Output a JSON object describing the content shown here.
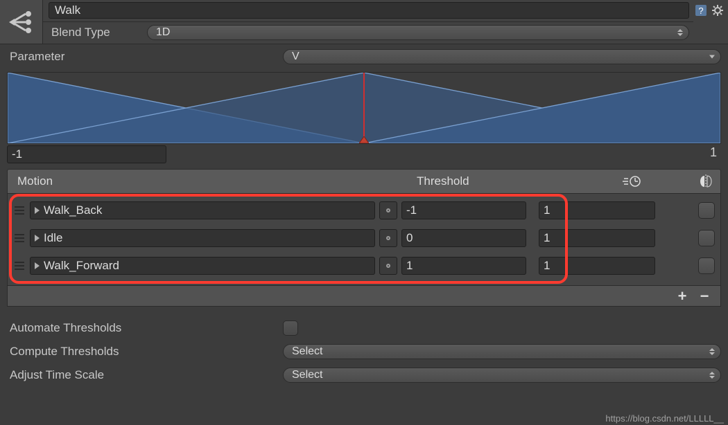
{
  "header": {
    "name": "Walk",
    "blend_type_label": "Blend Type",
    "blend_type_value": "1D"
  },
  "parameter": {
    "label": "Parameter",
    "value": "V"
  },
  "axis": {
    "min": "-1",
    "max": "1"
  },
  "columns": {
    "motion": "Motion",
    "threshold": "Threshold"
  },
  "motions": [
    {
      "name": "Walk_Back",
      "threshold": "-1",
      "speed": "1"
    },
    {
      "name": "Idle",
      "threshold": "0",
      "speed": "1"
    },
    {
      "name": "Walk_Forward",
      "threshold": "1",
      "speed": "1"
    }
  ],
  "options": {
    "automate_label": "Automate Thresholds",
    "compute_label": "Compute Thresholds",
    "adjust_label": "Adjust Time Scale",
    "compute_value": "Select",
    "adjust_value": "Select"
  },
  "watermark": "https://blog.csdn.net/LLLLL__"
}
